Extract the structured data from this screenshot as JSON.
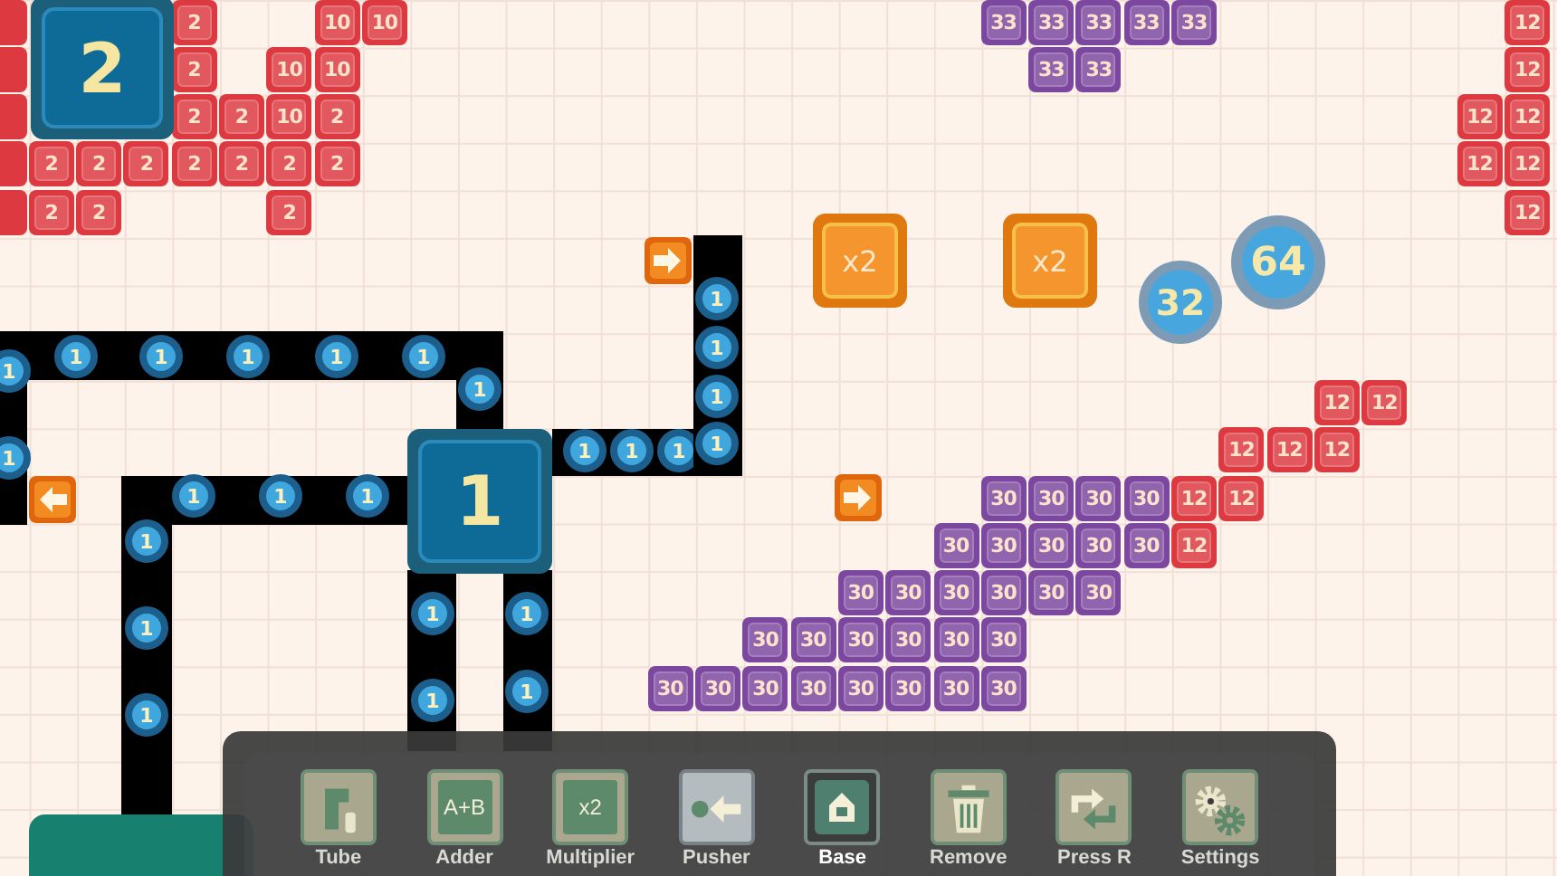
{
  "number_tiles": [
    {
      "label": "2",
      "color": "#dc3a40"
    },
    {
      "label": "10",
      "color": "#dc3a40"
    },
    {
      "label": "10",
      "color": "#dc3a40"
    },
    {
      "label": "2",
      "color": "#dc3a40"
    },
    {
      "label": "10",
      "color": "#dc3a40"
    },
    {
      "label": "10",
      "color": "#dc3a40"
    },
    {
      "label": "2",
      "color": "#dc3a40"
    },
    {
      "label": "2",
      "color": "#dc3a40"
    },
    {
      "label": "10",
      "color": "#dc3a40"
    },
    {
      "label": "2",
      "color": "#dc3a40"
    },
    {
      "label": "2",
      "color": "#dc3a40"
    },
    {
      "label": "2",
      "color": "#dc3a40"
    },
    {
      "label": "2",
      "color": "#dc3a40"
    },
    {
      "label": "2",
      "color": "#dc3a40"
    },
    {
      "label": "2",
      "color": "#dc3a40"
    },
    {
      "label": "2",
      "color": "#dc3a40"
    },
    {
      "label": "2",
      "color": "#dc3a40"
    },
    {
      "label": "2",
      "color": "#dc3a40"
    },
    {
      "label": "2",
      "color": "#dc3a40"
    },
    {
      "label": "2",
      "color": "#dc3a40"
    },
    {
      "label": "33",
      "color": "#7c479f"
    },
    {
      "label": "33",
      "color": "#7c479f"
    },
    {
      "label": "33",
      "color": "#7c479f"
    },
    {
      "label": "33",
      "color": "#7c479f"
    },
    {
      "label": "33",
      "color": "#7c479f"
    },
    {
      "label": "33",
      "color": "#7c479f"
    },
    {
      "label": "33",
      "color": "#7c479f"
    },
    {
      "label": "12",
      "color": "#dc3a40"
    },
    {
      "label": "12",
      "color": "#dc3a40"
    },
    {
      "label": "12",
      "color": "#dc3a40"
    },
    {
      "label": "12",
      "color": "#dc3a40"
    },
    {
      "label": "12",
      "color": "#dc3a40"
    },
    {
      "label": "12",
      "color": "#dc3a40"
    },
    {
      "label": "12",
      "color": "#dc3a40"
    },
    {
      "label": "12",
      "color": "#dc3a40"
    },
    {
      "label": "12",
      "color": "#dc3a40"
    },
    {
      "label": "12",
      "color": "#dc3a40"
    },
    {
      "label": "12",
      "color": "#dc3a40"
    },
    {
      "label": "12",
      "color": "#dc3a40"
    },
    {
      "label": "30",
      "color": "#7c479f"
    },
    {
      "label": "30",
      "color": "#7c479f"
    },
    {
      "label": "30",
      "color": "#7c479f"
    },
    {
      "label": "30",
      "color": "#7c479f"
    },
    {
      "label": "12",
      "color": "#dc3a40"
    },
    {
      "label": "12",
      "color": "#dc3a40"
    },
    {
      "label": "30",
      "color": "#7c479f"
    },
    {
      "label": "30",
      "color": "#7c479f"
    },
    {
      "label": "30",
      "color": "#7c479f"
    },
    {
      "label": "30",
      "color": "#7c479f"
    },
    {
      "label": "30",
      "color": "#7c479f"
    },
    {
      "label": "12",
      "color": "#dc3a40"
    },
    {
      "label": "30",
      "color": "#7c479f"
    },
    {
      "label": "30",
      "color": "#7c479f"
    },
    {
      "label": "30",
      "color": "#7c479f"
    },
    {
      "label": "30",
      "color": "#7c479f"
    },
    {
      "label": "30",
      "color": "#7c479f"
    },
    {
      "label": "30",
      "color": "#7c479f"
    },
    {
      "label": "30",
      "color": "#7c479f"
    },
    {
      "label": "30",
      "color": "#7c479f"
    },
    {
      "label": "30",
      "color": "#7c479f"
    },
    {
      "label": "30",
      "color": "#7c479f"
    },
    {
      "label": "30",
      "color": "#7c479f"
    },
    {
      "label": "30",
      "color": "#7c479f"
    },
    {
      "label": "30",
      "color": "#7c479f"
    },
    {
      "label": "30",
      "color": "#7c479f"
    },
    {
      "label": "30",
      "color": "#7c479f"
    },
    {
      "label": "30",
      "color": "#7c479f"
    },
    {
      "label": "30",
      "color": "#7c479f"
    },
    {
      "label": "30",
      "color": "#7c479f"
    },
    {
      "label": "30",
      "color": "#7c479f"
    },
    {
      "label": "30",
      "color": "#7c479f"
    }
  ],
  "bases": [
    {
      "label": "2"
    },
    {
      "label": "1"
    }
  ],
  "tube_items": [
    {
      "label": "1"
    },
    {
      "label": "1"
    },
    {
      "label": "1"
    },
    {
      "label": "1"
    },
    {
      "label": "1"
    },
    {
      "label": "1"
    },
    {
      "label": "1"
    },
    {
      "label": "1"
    },
    {
      "label": "1"
    },
    {
      "label": "1"
    },
    {
      "label": "1"
    },
    {
      "label": "1"
    },
    {
      "label": "1"
    },
    {
      "label": "1"
    },
    {
      "label": "1"
    },
    {
      "label": "1"
    },
    {
      "label": "1"
    },
    {
      "label": "1"
    },
    {
      "label": "1"
    },
    {
      "label": "1"
    },
    {
      "label": "1"
    },
    {
      "label": "1"
    },
    {
      "label": "1"
    },
    {
      "label": "1"
    },
    {
      "label": "1"
    }
  ],
  "pushers": [
    {
      "kind": "right"
    },
    {
      "kind": "left"
    },
    {
      "kind": "right"
    }
  ],
  "multipliers": [
    {
      "label": "x2"
    },
    {
      "label": "x2"
    }
  ],
  "orbs": [
    {
      "label": "32"
    },
    {
      "label": "64"
    }
  ],
  "toolbar": [
    {
      "kind": "tube",
      "label": "Tube",
      "selected": false,
      "highlighted": false
    },
    {
      "kind": "adder",
      "label": "Adder",
      "icon_text": "A+B",
      "selected": false,
      "highlighted": false
    },
    {
      "kind": "multiplier",
      "label": "Multiplier",
      "icon_text": "x2",
      "selected": false,
      "highlighted": false
    },
    {
      "kind": "pusher",
      "label": "Pusher",
      "selected": false,
      "highlighted": true
    },
    {
      "kind": "base",
      "label": "Base",
      "selected": true,
      "highlighted": false
    },
    {
      "kind": "remove",
      "label": "Remove",
      "selected": false,
      "highlighted": false
    },
    {
      "kind": "rotate",
      "label": "Press R",
      "selected": false,
      "highlighted": false
    },
    {
      "kind": "settings",
      "label": "Settings",
      "selected": false,
      "highlighted": false
    }
  ]
}
